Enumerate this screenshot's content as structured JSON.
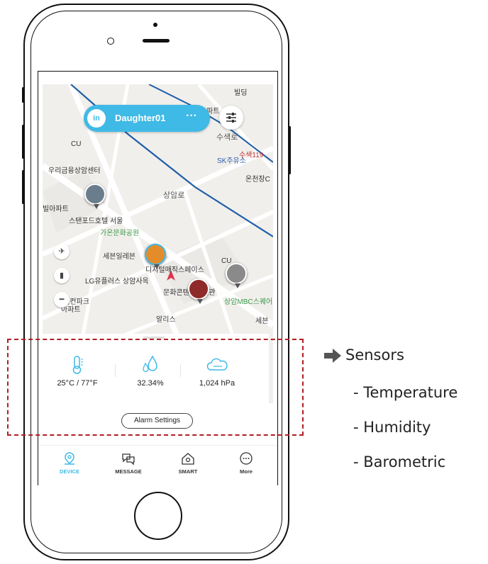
{
  "map": {
    "labels": [
      "파트",
      "빌딩",
      "CU",
      "수색로",
      "수색119",
      "SK주유소",
      "우리금융상암센터",
      "온천장C",
      "빌아파트",
      "상암로",
      "스탠포드호텔 서울",
      "가온문화공원",
      "세븐일레븐",
      "디지털매직스페이스",
      "CU",
      "LG유플러스 상암사옥",
      "문화콘텐츠도서관",
      "드림컨파크",
      "아파트",
      "상암MBC스퀘어트장",
      "알리스",
      "세븐"
    ]
  },
  "device_chip": {
    "icon": "in",
    "name": "Daughter01",
    "menu": "···"
  },
  "sensors": {
    "temperature": "25°C / 77°F",
    "humidity": "32.34%",
    "pressure": "1,024 hPa"
  },
  "alarm_button": "Alarm Settings",
  "nav": {
    "device": "DEVICE",
    "message": "MESSAGE",
    "smart": "SMART",
    "more": "More"
  },
  "annotations": {
    "title": "Sensors",
    "items": [
      "- Temperature",
      "- Humidity",
      "- Barometric"
    ]
  },
  "colors": {
    "accent": "#3fb9e6",
    "highlight": "#b01f24",
    "road_blue": "#1f5fa8"
  }
}
